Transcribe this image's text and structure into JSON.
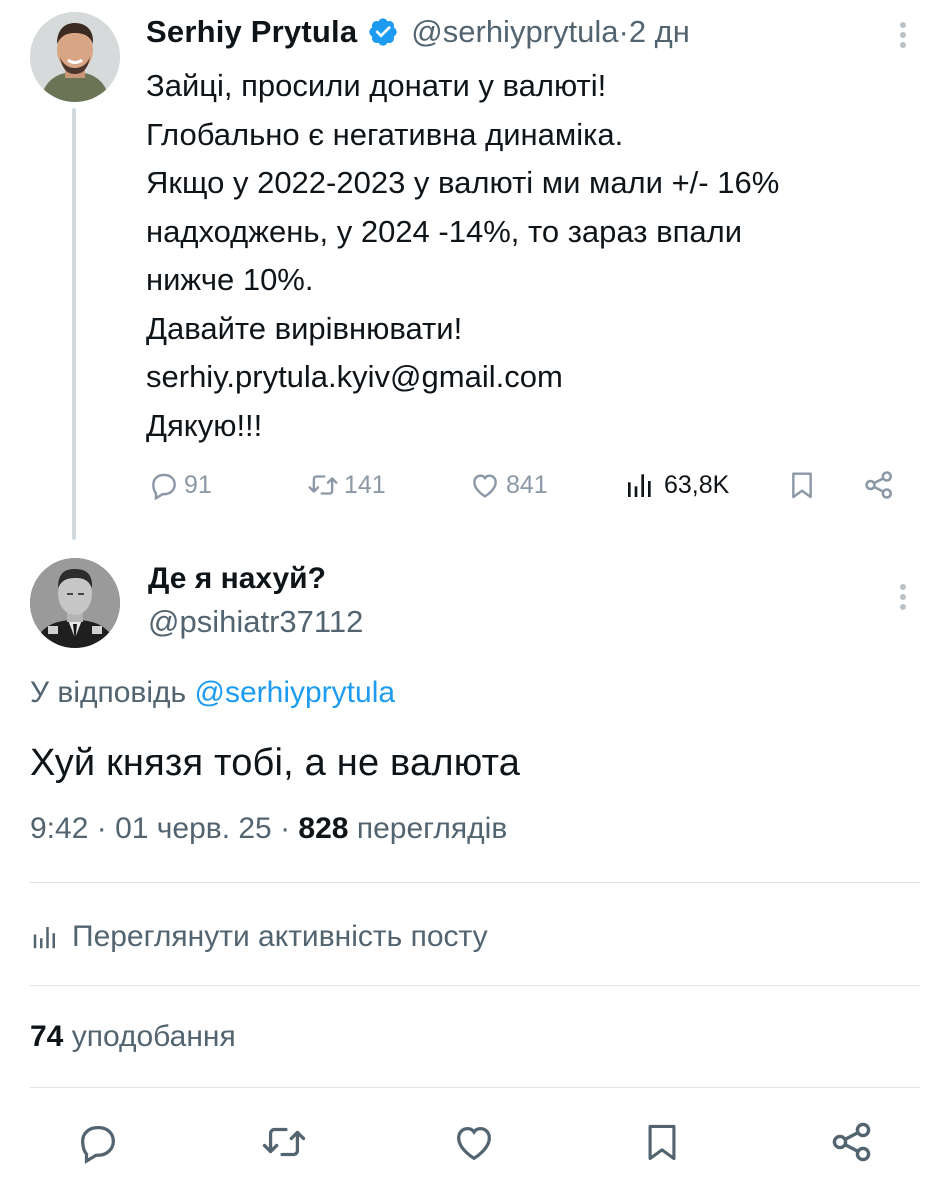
{
  "parent_tweet": {
    "author_name": "Serhiy Prytula",
    "verified": true,
    "handle": "@serhiyprytula",
    "separator": " · ",
    "time": "2 дн",
    "text_lines": [
      "Зайці, просили донати у валюті!",
      "Глобально є негативна динаміка.",
      "Якщо у 2022-2023 у валюті ми мали +/- 16%",
      "надходжень, у 2024 -14%, то зараз впали",
      "нижче 10%.",
      "Давайте вирівнювати!",
      "serhiy.prytula.kyiv@gmail.com",
      "Дякую!!!"
    ],
    "stats": {
      "replies": "91",
      "reposts": "141",
      "likes": "841",
      "views": "63,8K"
    }
  },
  "reply_tweet": {
    "author_name": "Де я нахуй?",
    "handle": "@psihiatr37112",
    "reply_to_prefix": "У відповідь",
    "reply_to_handle": "@serhiyprytula",
    "text": "Хуй князя тобі, а не валюта",
    "time": "9:42",
    "date": "01 черв. 25",
    "separator": " · ",
    "views_count": "828",
    "views_label": "переглядів"
  },
  "post_activity_label": "Переглянути активність посту",
  "likes_summary": {
    "count": "74",
    "label": "уподобання"
  },
  "colors": {
    "text_primary": "#0f1419",
    "text_secondary": "#536471",
    "accent_blue": "#1d9bf0",
    "icon_gray": "#8b98a5",
    "divider": "#dfe3e6"
  },
  "icons": {
    "reply": "reply-icon",
    "repost": "repost-icon",
    "like": "heart-icon",
    "views": "views-chart-icon",
    "bookmark": "bookmark-icon",
    "share": "share-icon",
    "more": "more-vertical-icon",
    "verified": "verified-badge-icon"
  }
}
